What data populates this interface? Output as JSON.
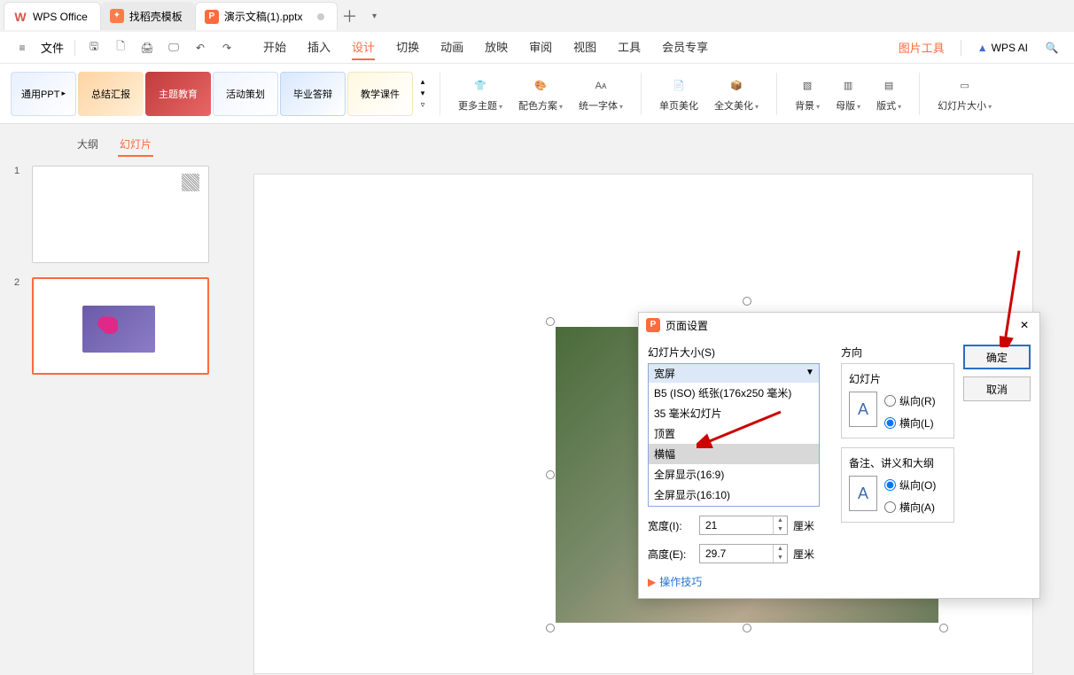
{
  "tabs": {
    "wps_office": "WPS Office",
    "template": "找稻壳模板",
    "doc": "演示文稿(1).pptx"
  },
  "toolbar": {
    "file": "文件"
  },
  "menu": {
    "start": "开始",
    "insert": "插入",
    "design": "设计",
    "transition": "切换",
    "animation": "动画",
    "slideshow": "放映",
    "review": "审阅",
    "view": "视图",
    "tools": "工具",
    "member": "会员专享",
    "picture_tools": "图片工具",
    "wps_ai": "WPS AI"
  },
  "ribbon": {
    "theme1": "通用PPT",
    "theme2": "总结汇报",
    "theme3": "主题教育",
    "theme4": "活动策划",
    "theme5": "毕业答辩",
    "theme6": "教学课件",
    "more_themes": "更多主题",
    "color_scheme": "配色方案",
    "unify_font": "统一字体",
    "page_beautify": "单页美化",
    "full_beautify": "全文美化",
    "background": "背景",
    "master": "母版",
    "layout": "版式",
    "slide_size": "幻灯片大小"
  },
  "panel": {
    "outline": "大纲",
    "slides": "幻灯片",
    "slide1": "1",
    "slide2": "2"
  },
  "dialog": {
    "title": "页面设置",
    "slide_size_label": "幻灯片大小(S)",
    "combo_value": "宽屏",
    "opt_b5": "B5 (ISO) 纸张(176x250 毫米)",
    "opt_35mm": "35 毫米幻灯片",
    "opt_top": "顶置",
    "opt_banner": "横幅",
    "opt_169": "全屏显示(16:9)",
    "opt_1610": "全屏显示(16:10)",
    "opt_wide": "宽屏",
    "width_label": "宽度(I):",
    "width_value": "21",
    "width_unit": "厘米",
    "height_label": "高度(E):",
    "height_value": "29.7",
    "height_unit": "厘米",
    "tips": "操作技巧",
    "direction": "方向",
    "slide_group": "幻灯片",
    "portrait_r": "纵向(R)",
    "landscape_l": "横向(L)",
    "notes_group": "备注、讲义和大纲",
    "portrait_o": "纵向(O)",
    "landscape_a": "横向(A)",
    "ok": "确定",
    "cancel": "取消"
  }
}
